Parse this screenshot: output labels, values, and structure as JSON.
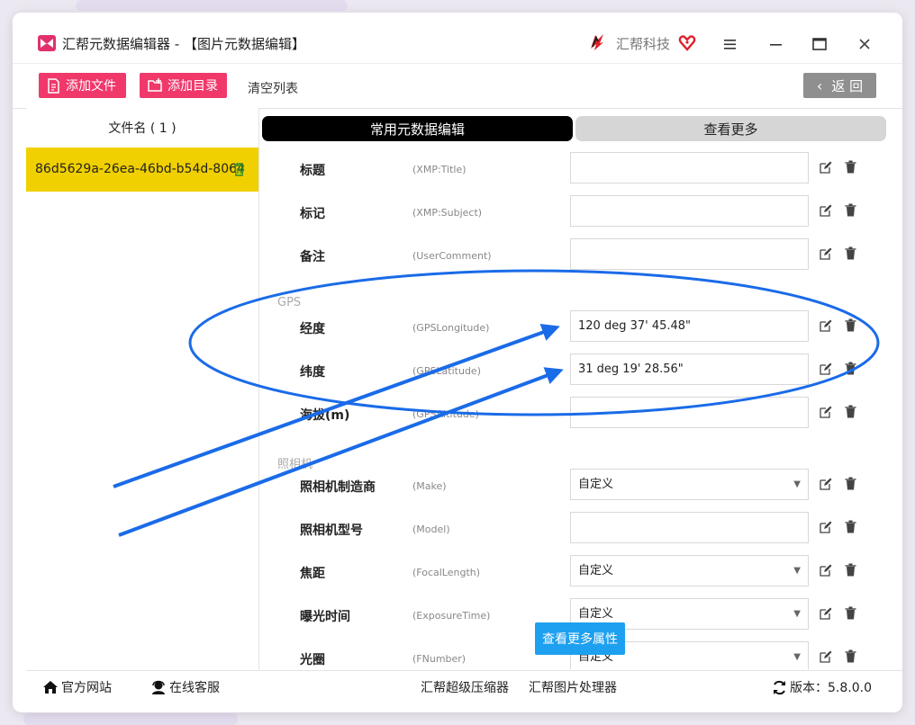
{
  "window": {
    "title": "汇帮元数据编辑器 - 【图片元数据编辑】",
    "brand": "汇帮科技"
  },
  "toolbar": {
    "add_file": "添加文件",
    "add_dir": "添加目录",
    "clear_list": "清空列表",
    "back": "返 回"
  },
  "file_list": {
    "header": "文件名 ( 1 )",
    "items": [
      "86d5629a-26ea-46bd-b54d-8064"
    ]
  },
  "tabs": {
    "common": "常用元数据编辑",
    "more": "查看更多"
  },
  "sections": {
    "gps": "GPS",
    "camera": "照相机"
  },
  "fields": [
    {
      "label": "标题",
      "key": "(XMP:Title)",
      "value": ""
    },
    {
      "label": "标记",
      "key": "(XMP:Subject)",
      "value": ""
    },
    {
      "label": "备注",
      "key": "(UserComment)",
      "value": ""
    },
    {
      "label": "经度",
      "key": "(GPSLongitude)",
      "value": "120 deg 37' 45.48\""
    },
    {
      "label": "纬度",
      "key": "(GPSLatitude)",
      "value": "31 deg 19' 28.56\""
    },
    {
      "label": "海拔(m)",
      "key": "(GPSAltitude)",
      "value": ""
    },
    {
      "label": "照相机制造商",
      "key": "(Make)",
      "value": "自定义"
    },
    {
      "label": "照相机型号",
      "key": "(Model)",
      "value": ""
    },
    {
      "label": "焦距",
      "key": "(FocalLength)",
      "value": "自定义"
    },
    {
      "label": "曝光时间",
      "key": "(ExposureTime)",
      "value": "自定义"
    },
    {
      "label": "光圈",
      "key": "(FNumber)",
      "value": "自定义"
    }
  ],
  "more_button": "查看更多属性",
  "footer": {
    "website": "官方网站",
    "support": "在线客服",
    "compressor": "汇帮超级压缩器",
    "image_tool": "汇帮图片处理器",
    "version": "版本：5.8.0.0"
  },
  "colors": {
    "accent_pink": "#f0386b",
    "selection_yellow": "#f0d000",
    "annotation_blue": "#1a6be8",
    "more_button_blue": "#1ea0f0"
  }
}
